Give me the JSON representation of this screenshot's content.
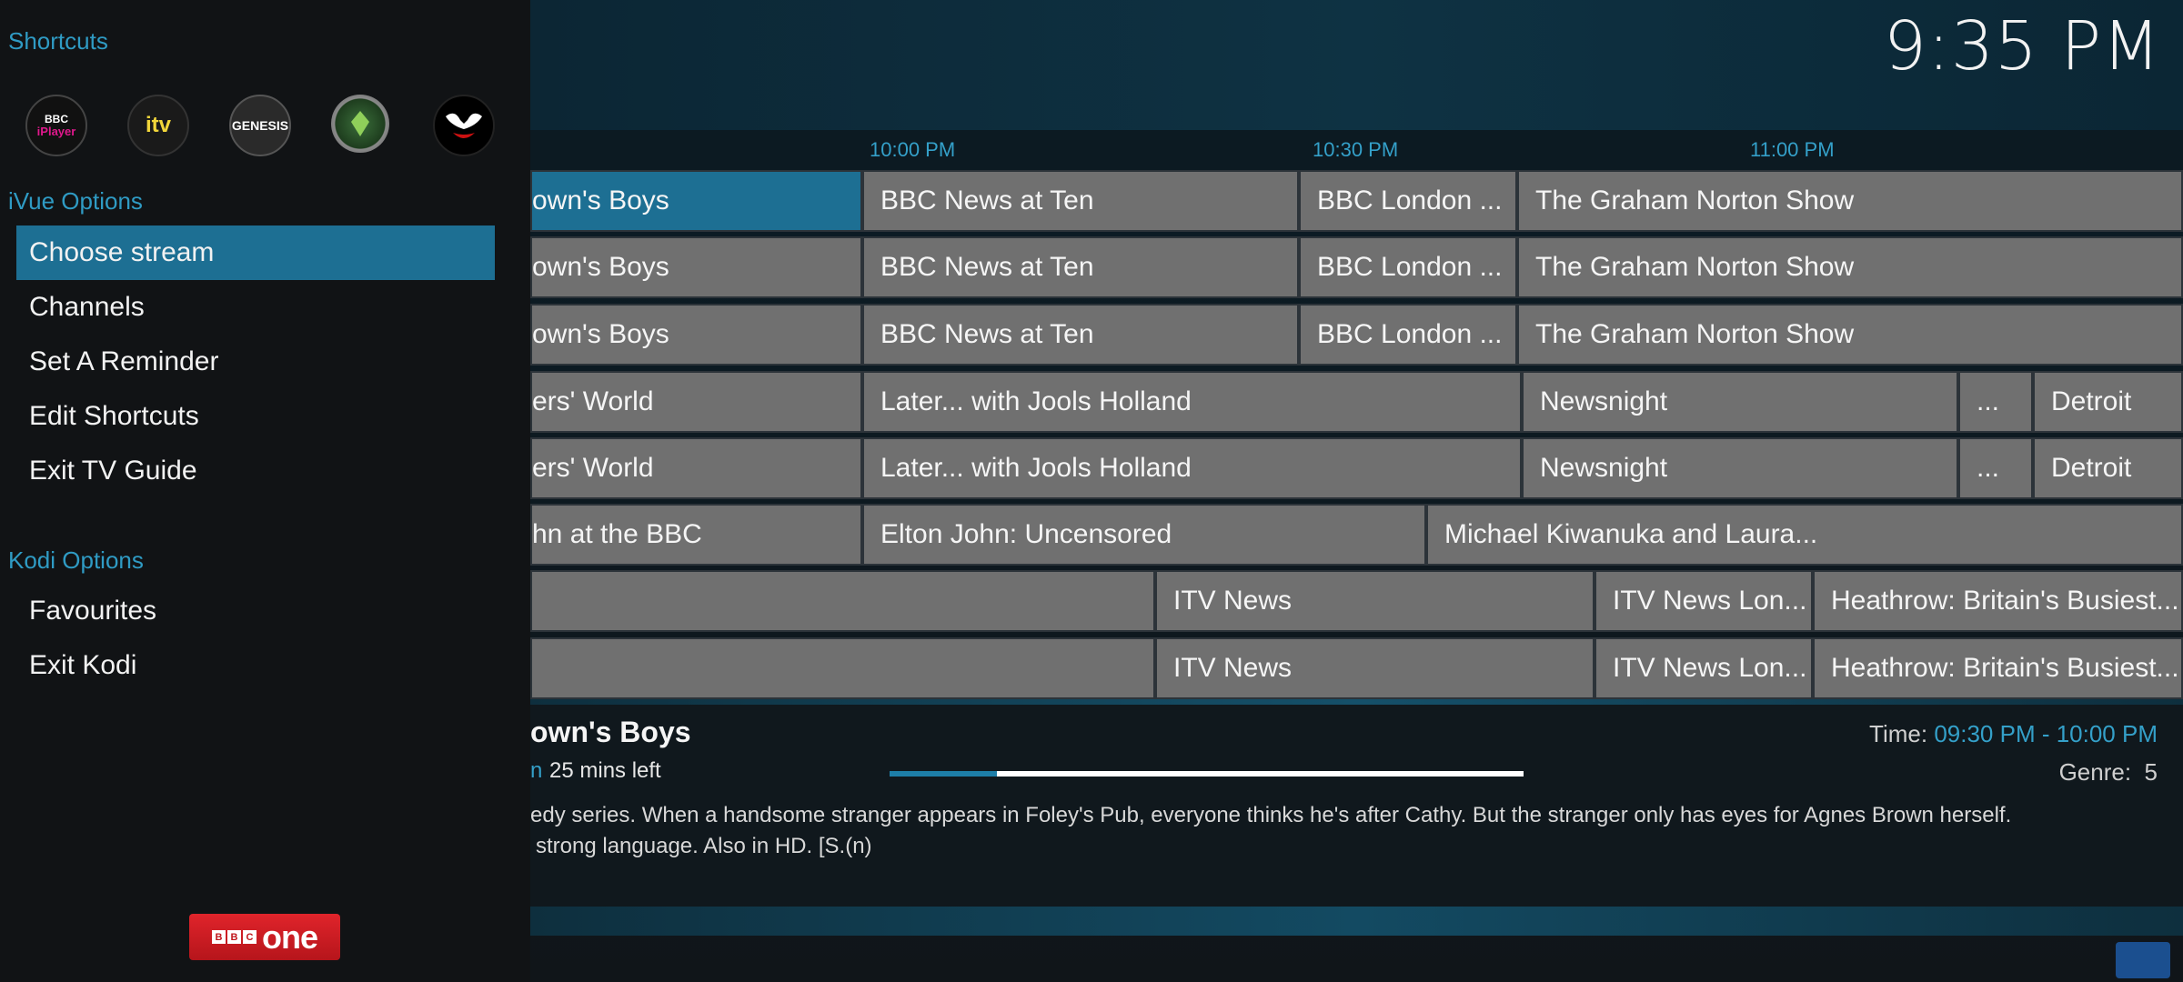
{
  "clock": "9:35 PM",
  "timeline": [
    "10:00 PM",
    "10:30 PM",
    "11:00 PM"
  ],
  "epg_rows": [
    [
      {
        "t": "own's Boys"
      },
      {
        "t": "BBC News at Ten"
      },
      {
        "t": "BBC London ..."
      },
      {
        "t": "The Graham Norton Show"
      }
    ],
    [
      {
        "t": "own's Boys"
      },
      {
        "t": "BBC News at Ten"
      },
      {
        "t": "BBC London ..."
      },
      {
        "t": "The Graham Norton Show"
      }
    ],
    [
      {
        "t": "own's Boys"
      },
      {
        "t": "BBC News at Ten"
      },
      {
        "t": "BBC London ..."
      },
      {
        "t": "The Graham Norton Show"
      }
    ],
    [
      {
        "t": "ers' World"
      },
      {
        "t": "Later... with Jools Holland"
      },
      {
        "t": "Newsnight"
      },
      {
        "t": "..."
      },
      {
        "t": "Detroit"
      }
    ],
    [
      {
        "t": "ers' World"
      },
      {
        "t": "Later... with Jools Holland"
      },
      {
        "t": "Newsnight"
      },
      {
        "t": "..."
      },
      {
        "t": "Detroit"
      }
    ],
    [
      {
        "t": "hn at the BBC"
      },
      {
        "t": "Elton John: Uncensored"
      },
      {
        "t": "Michael Kiwanuka and Laura..."
      }
    ],
    [
      {
        "t": ""
      },
      {
        "t": "ITV News"
      },
      {
        "t": "ITV News Lon..."
      },
      {
        "t": "Heathrow: Britain's Busiest..."
      }
    ],
    [
      {
        "t": ""
      },
      {
        "t": "ITV News"
      },
      {
        "t": "ITV News Lon..."
      },
      {
        "t": "Heathrow: Britain's Busiest..."
      }
    ]
  ],
  "info": {
    "title": "own's Boys",
    "left_accent": "n",
    "time_left": "25 mins left",
    "progress": 0.17,
    "time_label": "Time:",
    "time_value": "09:30 PM - 10:00 PM",
    "genre_label": "Genre:",
    "genre_value": "5",
    "desc_line1": "edy series. When a handsome stranger appears in Foley's Pub, everyone thinks he's after Cathy. But the stranger only has eyes for Agnes Brown herself.",
    "desc_line2": "strong language. Also in HD. [S.(n)"
  },
  "side": {
    "shortcuts_title": "Shortcuts",
    "shortcuts": [
      {
        "name": "bbc-iplayer-icon",
        "label": "BBC iPlayer"
      },
      {
        "name": "itv-icon",
        "label": "itv"
      },
      {
        "name": "genesis-icon",
        "label": "GENESIS"
      },
      {
        "name": "addon-green-icon",
        "label": ""
      },
      {
        "name": "venom-icon",
        "label": ""
      }
    ],
    "ivue_title": "iVue Options",
    "ivue_items": [
      "Choose stream",
      "Channels",
      "Set A Reminder",
      "Edit Shortcuts",
      "Exit TV Guide"
    ],
    "kodi_title": "Kodi Options",
    "kodi_items": [
      "Favourites",
      "Exit Kodi"
    ],
    "channel_logo": {
      "blocks": [
        "B",
        "B",
        "C"
      ],
      "word": "one"
    }
  }
}
